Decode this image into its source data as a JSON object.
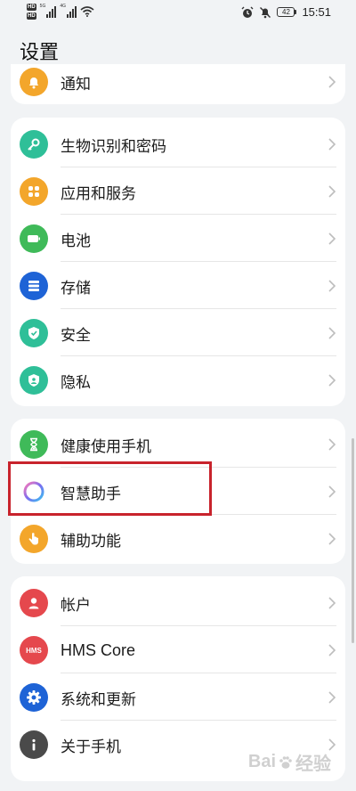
{
  "status_bar": {
    "hd1": "HD",
    "hd2": "HD",
    "gen1": "5G",
    "gen2": "4G",
    "battery": "42",
    "time": "15:51"
  },
  "page": {
    "title": "设置"
  },
  "groups": [
    {
      "items": [
        {
          "label": "通知",
          "icon": "bell-icon",
          "color": "#f3a62b"
        }
      ]
    },
    {
      "items": [
        {
          "label": "生物识别和密码",
          "icon": "key-icon",
          "color": "#2fbf98"
        },
        {
          "label": "应用和服务",
          "icon": "apps-grid-icon",
          "color": "#f3a62b"
        },
        {
          "label": "电池",
          "icon": "battery-icon",
          "color": "#3fba59"
        },
        {
          "label": "存储",
          "icon": "storage-icon",
          "color": "#1e63d6"
        },
        {
          "label": "安全",
          "icon": "shield-icon",
          "color": "#2fbf98"
        },
        {
          "label": "隐私",
          "icon": "privacy-icon",
          "color": "#2fbf98"
        }
      ]
    },
    {
      "items": [
        {
          "label": "健康使用手机",
          "icon": "hourglass-icon",
          "color": "#3fba59"
        },
        {
          "label": "智慧助手",
          "icon": "assistant-ring-icon",
          "color": "#7a6cf0"
        },
        {
          "label": "辅助功能",
          "icon": "hand-icon",
          "color": "#f3a62b"
        }
      ]
    },
    {
      "items": [
        {
          "label": "帐户",
          "icon": "account-icon",
          "color": "#e5484d"
        },
        {
          "label": "HMS Core",
          "icon": "hms-icon",
          "color": "#e5484d"
        },
        {
          "label": "系统和更新",
          "icon": "gear-icon",
          "color": "#1e63d6"
        },
        {
          "label": "关于手机",
          "icon": "info-icon",
          "color": "#4a4a4a"
        }
      ]
    }
  ],
  "hms_badge": "HMS",
  "watermark": {
    "text1": "Bai",
    "text2": "经验"
  }
}
